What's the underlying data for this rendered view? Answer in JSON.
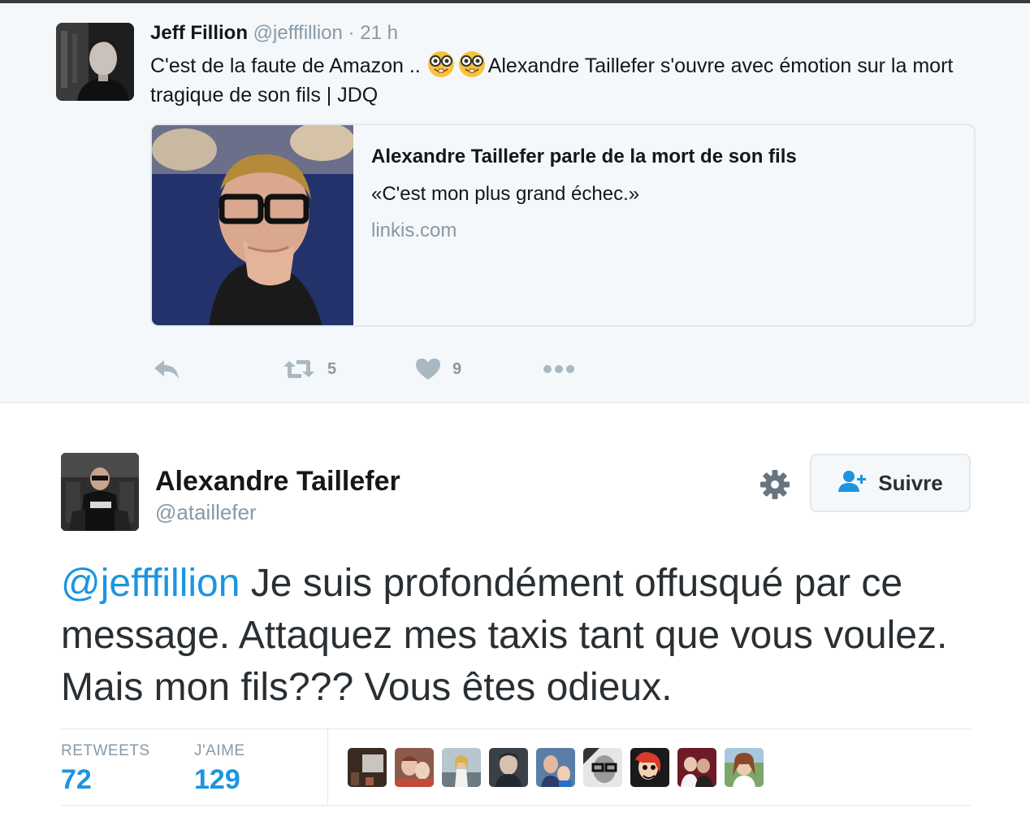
{
  "quoted_tweet": {
    "author_name": "Jeff Fillion",
    "author_handle": "@jefffillion",
    "separator": "·",
    "time": "21 h",
    "text_before": "C'est de la faute de Amazon .. ",
    "text_after": "Alexandre Taillefer s'ouvre avec émotion sur la mort tragique de son fils | JDQ",
    "emojis": [
      "nerd-face",
      "nerd-face"
    ],
    "card": {
      "title": "Alexandre Taillefer parle de la mort de son fils",
      "description": "«C'est mon plus grand échec.»",
      "domain": "linkis.com"
    },
    "actions": {
      "reply_icon": "reply-icon",
      "retweet_icon": "retweet-icon",
      "retweet_count": "5",
      "like_icon": "heart-icon",
      "like_count": "9",
      "more_icon": "more-icon"
    }
  },
  "main_tweet": {
    "author_name": "Alexandre Taillefer",
    "author_handle": "@ataillefer",
    "follow_label": "Suivre",
    "mention": "@jefffillion",
    "text": " Je suis profondément offusqué par ce message.  Attaquez mes taxis tant que vous voulez.  Mais mon fils??? Vous êtes odieux.",
    "stats": {
      "retweets_label": "RETWEETS",
      "retweets_value": "72",
      "likes_label": "J'AIME",
      "likes_value": "129"
    },
    "liker_avatar_count": 9
  },
  "colors": {
    "link_blue": "#1b95e0",
    "muted_gray": "#8899a6",
    "text_dark": "#14171a",
    "panel_bg": "#f5f8fa",
    "border": "#e1e8ed"
  }
}
